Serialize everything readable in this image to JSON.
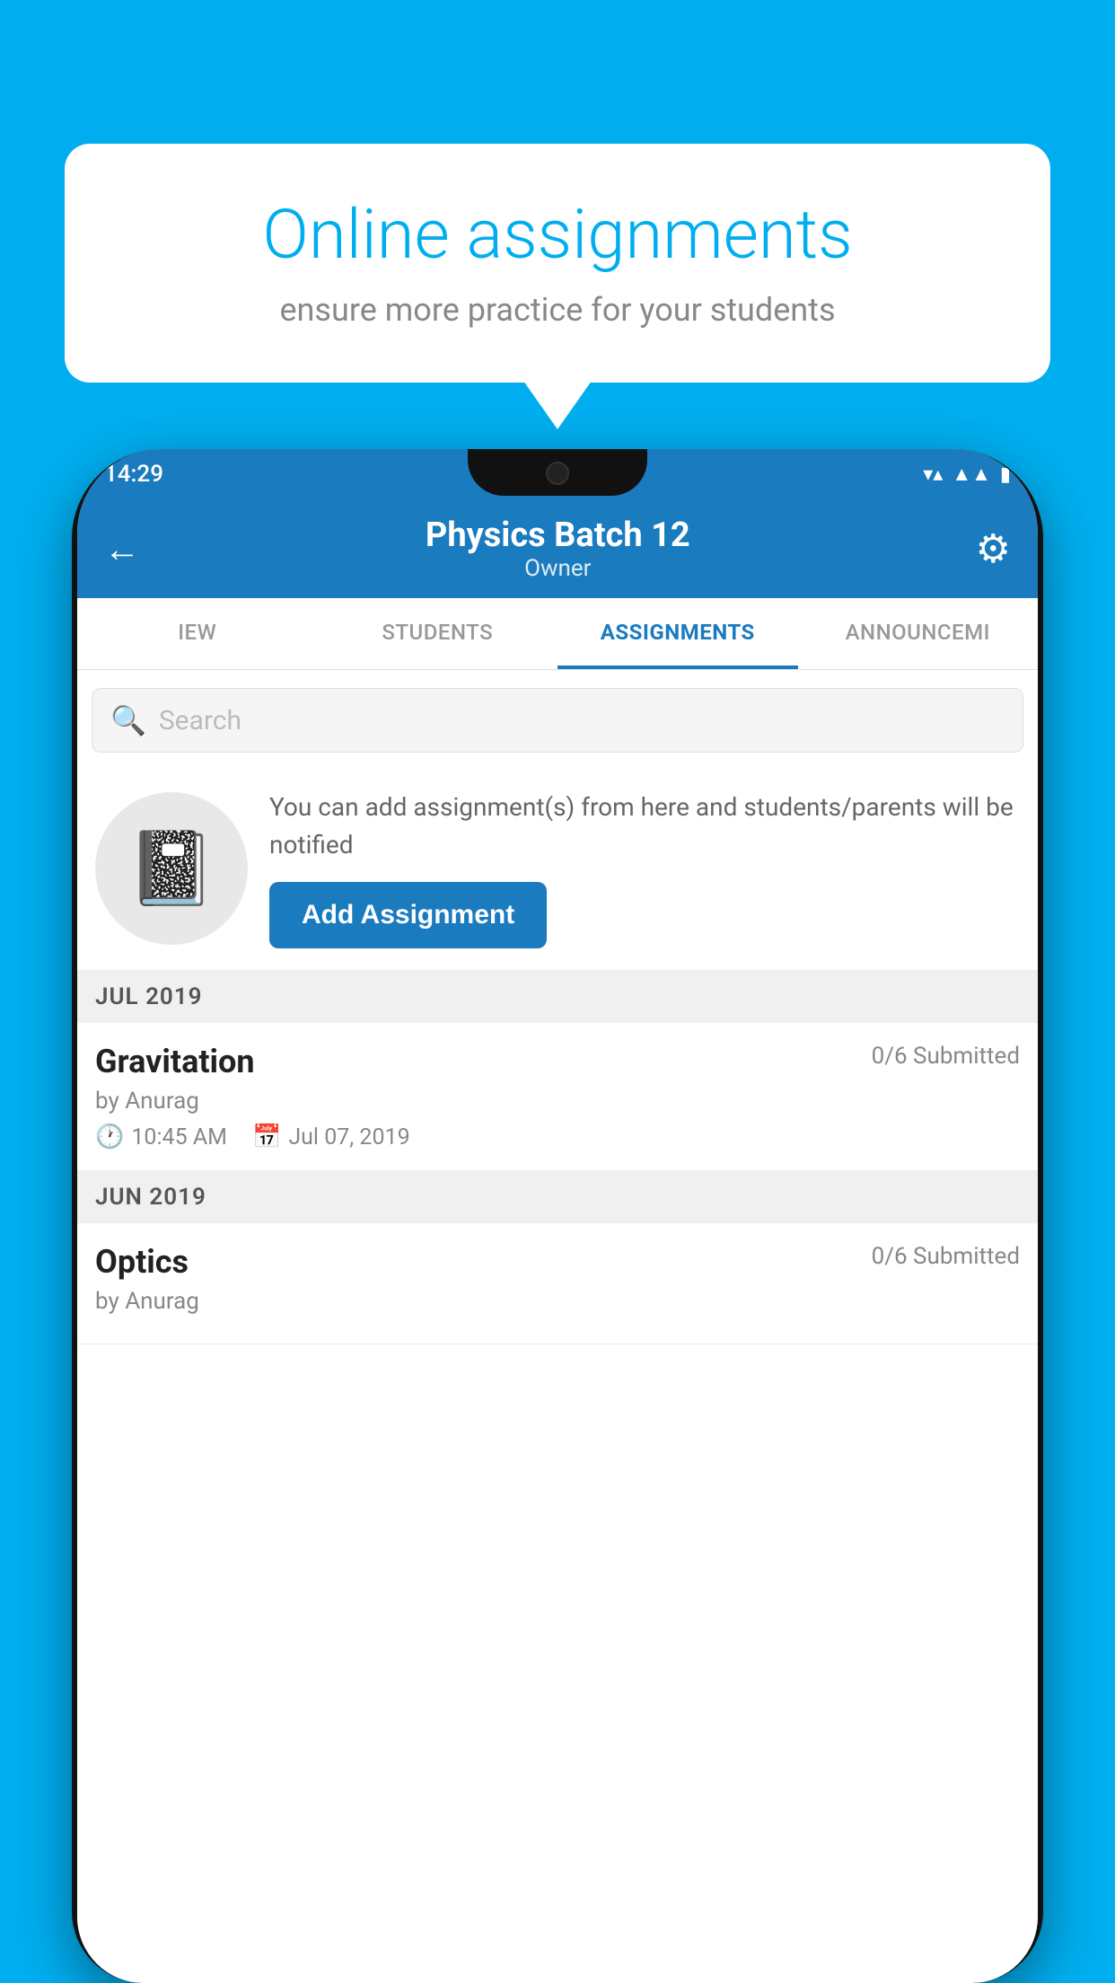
{
  "background_color": "#00AEEF",
  "tooltip": {
    "title": "Online assignments",
    "subtitle": "ensure more practice for your students"
  },
  "status_bar": {
    "time": "14:29",
    "icons": [
      "wifi",
      "signal",
      "battery"
    ]
  },
  "header": {
    "title": "Physics Batch 12",
    "subtitle": "Owner",
    "back_label": "←",
    "settings_label": "⚙"
  },
  "tabs": [
    {
      "label": "IEW",
      "active": false
    },
    {
      "label": "STUDENTS",
      "active": false
    },
    {
      "label": "ASSIGNMENTS",
      "active": true
    },
    {
      "label": "ANNOUNCEM",
      "active": false
    }
  ],
  "search": {
    "placeholder": "Search"
  },
  "add_assignment_section": {
    "description": "You can add assignment(s) from here and students/parents will be notified",
    "button_label": "Add Assignment"
  },
  "sections": [
    {
      "label": "JUL 2019",
      "assignments": [
        {
          "name": "Gravitation",
          "submitted": "0/6 Submitted",
          "author": "by Anurag",
          "time": "10:45 AM",
          "date": "Jul 07, 2019"
        }
      ]
    },
    {
      "label": "JUN 2019",
      "assignments": [
        {
          "name": "Optics",
          "submitted": "0/6 Submitted",
          "author": "by Anurag",
          "time": "",
          "date": ""
        }
      ]
    }
  ]
}
